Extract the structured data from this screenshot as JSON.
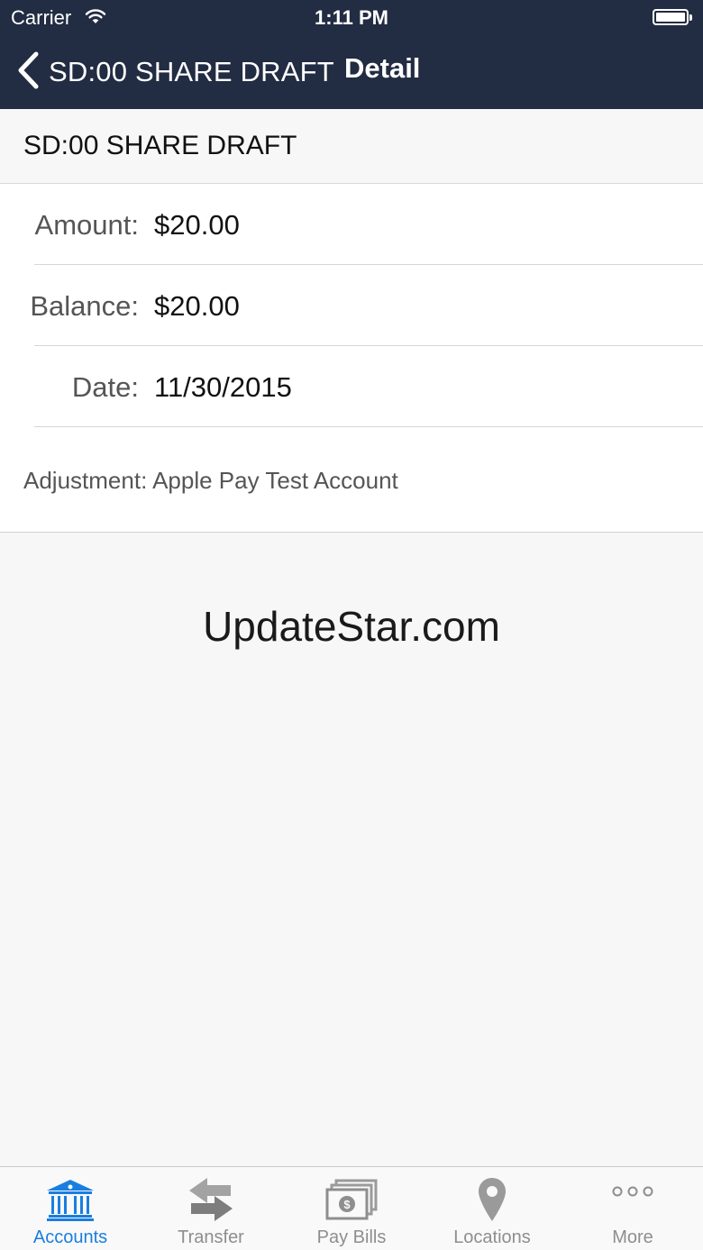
{
  "status_bar": {
    "carrier": "Carrier",
    "time": "1:11 PM"
  },
  "nav": {
    "back_label": "SD:00 SHARE DRAFT",
    "title": "Detail"
  },
  "section": {
    "title": "SD:00 SHARE DRAFT"
  },
  "details": [
    {
      "label": "Amount:",
      "value": "$20.00"
    },
    {
      "label": "Balance:",
      "value": "$20.00"
    },
    {
      "label": "Date:",
      "value": "11/30/2015"
    }
  ],
  "note": "Adjustment: Apple Pay Test Account",
  "watermark": "UpdateStar.com",
  "tabs": [
    {
      "label": "Accounts",
      "icon": "bank-icon",
      "active": true
    },
    {
      "label": "Transfer",
      "icon": "transfer-icon",
      "active": false
    },
    {
      "label": "Pay Bills",
      "icon": "bill-icon",
      "active": false
    },
    {
      "label": "Locations",
      "icon": "location-pin-icon",
      "active": false
    },
    {
      "label": "More",
      "icon": "more-icon",
      "active": false
    }
  ],
  "colors": {
    "navbar": "#222c42",
    "tab_active": "#1a7ee0",
    "tab_inactive": "#8e8e8e"
  }
}
